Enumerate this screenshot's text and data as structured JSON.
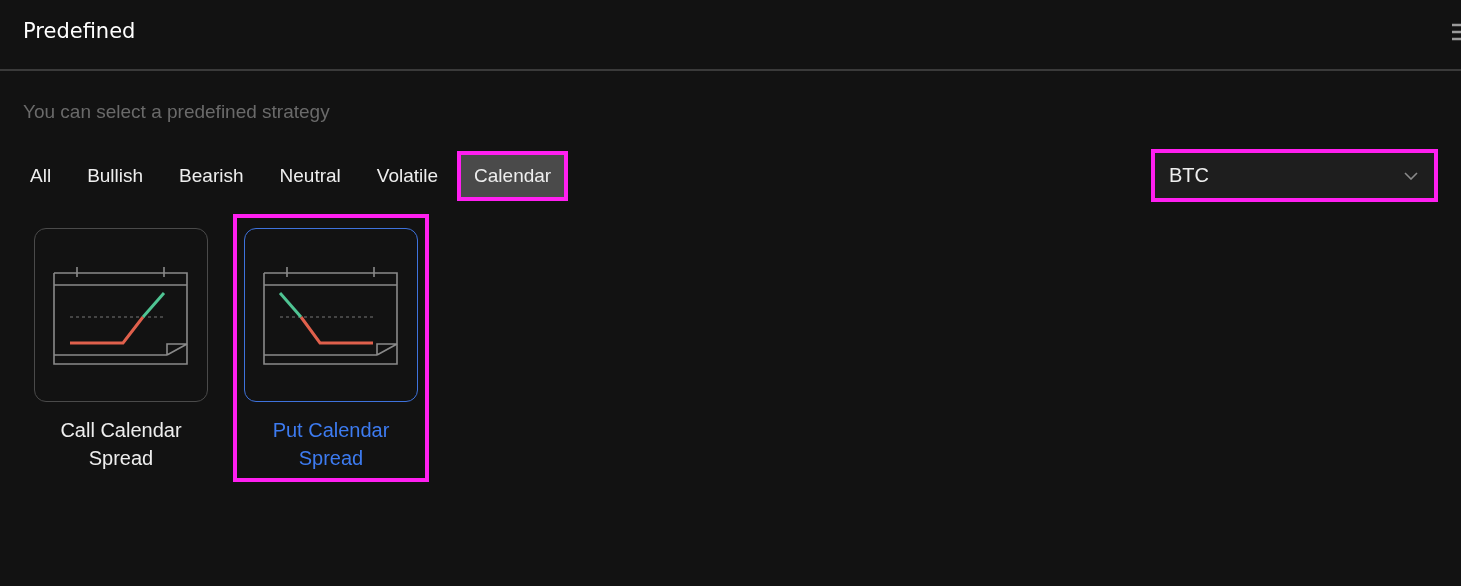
{
  "header": {
    "title": "Predefined"
  },
  "subtitle": "You can select a predefined strategy",
  "tabs": [
    {
      "label": "All",
      "selected": false,
      "highlighted": false
    },
    {
      "label": "Bullish",
      "selected": false,
      "highlighted": false
    },
    {
      "label": "Bearish",
      "selected": false,
      "highlighted": false
    },
    {
      "label": "Neutral",
      "selected": false,
      "highlighted": false
    },
    {
      "label": "Volatile",
      "selected": false,
      "highlighted": false
    },
    {
      "label": "Calendar",
      "selected": true,
      "highlighted": true
    }
  ],
  "asset_select": {
    "value": "BTC",
    "highlighted": true
  },
  "strategies": [
    {
      "kind": "call",
      "label": "Call Calendar Spread",
      "selected": false,
      "highlighted": false
    },
    {
      "kind": "put",
      "label": "Put Calendar Spread",
      "selected": true,
      "highlighted": true
    }
  ]
}
